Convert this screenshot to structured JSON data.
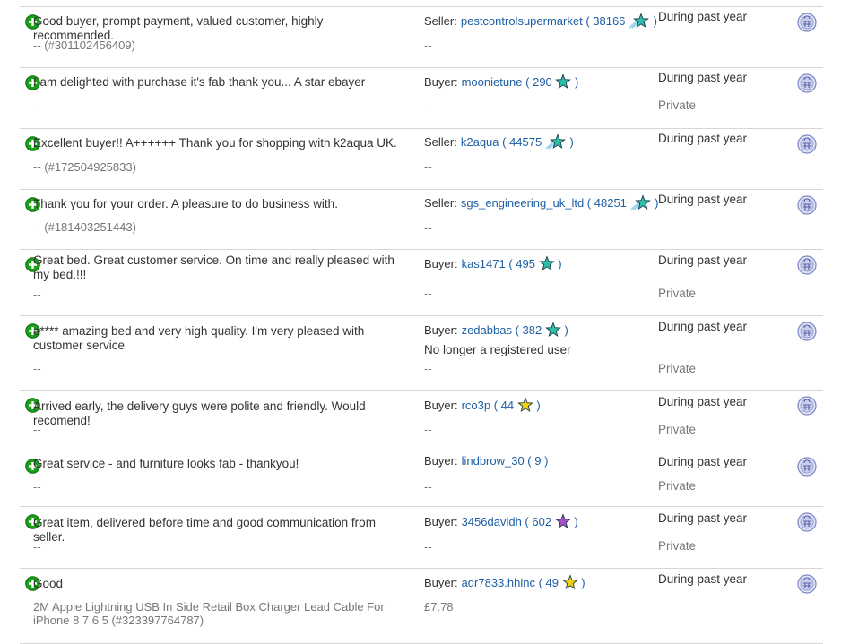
{
  "colors": {
    "link": "#1e5ea3",
    "positive": "#1aa01a",
    "separator": "#d6d6d6"
  },
  "icons": {
    "positive": "positive-feedback-icon",
    "stats": "feedback-stats-icon",
    "star_teal": "teal-star-icon",
    "star_teal_shooting": "teal-shooting-star-icon",
    "star_yellow": "yellow-star-icon",
    "star_purple": "purple-star-icon"
  },
  "rows": [
    {
      "comment": "Good buyer, prompt payment, valued customer, highly recommended.",
      "sub": "-- (#301102456409)",
      "role": "Seller:",
      "user": "pestcontrolsupermarket",
      "score": "38166",
      "star": "teal-shooting",
      "role_sub": "--",
      "when": "During past year",
      "privacy": ""
    },
    {
      "comment": "I am delighted with purchase it's fab thank you... A star ebayer",
      "sub": "--",
      "role": "Buyer:",
      "user": "moonietune",
      "score": "290",
      "star": "teal",
      "role_sub": "--",
      "when": "During past year",
      "privacy": "Private"
    },
    {
      "comment": "Excellent buyer!! A++++++ Thank you for shopping with k2aqua UK.",
      "sub": "-- (#172504925833)",
      "role": "Seller:",
      "user": "k2aqua",
      "score": "44575",
      "star": "teal-shooting",
      "role_sub": "--",
      "when": "During past year",
      "privacy": ""
    },
    {
      "comment": "Thank you for your order. A pleasure to do business with.",
      "sub": "-- (#181403251443)",
      "role": "Seller:",
      "user": "sgs_engineering_uk_ltd",
      "score": "48251",
      "star": "teal-shooting",
      "role_sub": "--",
      "when": "During past year",
      "privacy": ""
    },
    {
      "comment": "Great bed. Great customer service. On time and really pleased with my bed.!!!",
      "sub": "--",
      "role": "Buyer:",
      "user": "kas1471",
      "score": "495",
      "star": "teal",
      "role_sub": "--",
      "when": "During past year",
      "privacy": "Private"
    },
    {
      "comment": "a**** amazing bed and very high quality. I'm very pleased with customer service",
      "sub": "--",
      "role": "Buyer:",
      "user": "zedabbas",
      "score": "382",
      "star": "teal",
      "note": "No longer a registered user",
      "role_sub": "--",
      "when": "During past year",
      "privacy": "Private"
    },
    {
      "comment": "Arrived early, the delivery guys were polite and friendly. Would recomend!",
      "sub": "--",
      "role": "Buyer:",
      "user": "rco3p",
      "score": "44",
      "star": "yellow",
      "role_sub": "--",
      "when": "During past year",
      "privacy": "Private"
    },
    {
      "comment": "Great service - and furniture looks fab - thankyou!",
      "sub": "--",
      "role": "Buyer:",
      "user": "lindbrow_30",
      "score": "9",
      "star": "",
      "role_sub": "--",
      "when": "During past year",
      "privacy": "Private"
    },
    {
      "comment": "Great item, delivered before time and good communication from seller.",
      "sub": "--",
      "role": "Buyer:",
      "user": "3456davidh",
      "score": "602",
      "star": "purple",
      "role_sub": "--",
      "when": "During past year",
      "privacy": "Private"
    },
    {
      "comment": "Good",
      "sub": "2M Apple Lightning USB In Side Retail Box Charger Lead Cable For iPhone 8 7 6 5 (#323397764787)",
      "role": "Buyer:",
      "user": "adr7833.hhinc",
      "score": "49",
      "star": "yellow",
      "role_sub": "£7.78",
      "when": "During past year",
      "privacy": ""
    }
  ]
}
